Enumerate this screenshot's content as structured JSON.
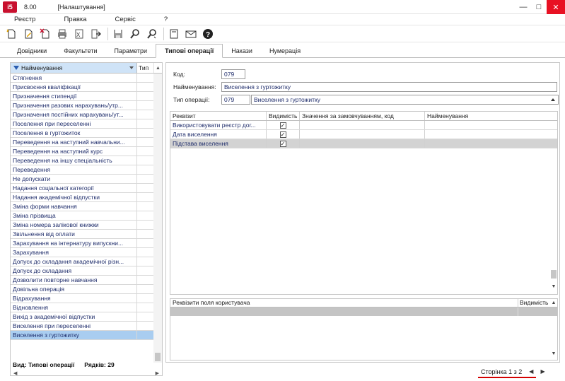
{
  "app": {
    "logo_text": "i5",
    "version": "8.00",
    "window_title": "[Налаштування]",
    "accent_color": "#c8102e"
  },
  "window_controls": {
    "minimize": "—",
    "maximize": "□",
    "close": "✕"
  },
  "menu": [
    {
      "label": "Реєстр"
    },
    {
      "label": "Правка"
    },
    {
      "label": "Сервіс"
    },
    {
      "label": "?"
    }
  ],
  "toolbar": {
    "icons": [
      "new-icon",
      "edit-icon",
      "delete-icon",
      "print-icon",
      "excel-icon",
      "export-icon",
      "save-icon",
      "search-icon",
      "search-next-icon",
      "form-icon",
      "mail-icon",
      "help-icon"
    ]
  },
  "tabs": [
    {
      "label": "Довідники",
      "active": false
    },
    {
      "label": "Факультети",
      "active": false
    },
    {
      "label": "Параметри",
      "active": false
    },
    {
      "label": "Типові операції",
      "active": true
    },
    {
      "label": "Накази",
      "active": false
    },
    {
      "label": "Нумерація",
      "active": false
    }
  ],
  "left_list": {
    "col_name": "Найменування",
    "col_type": "Тип",
    "items": [
      "Стягнення",
      "Присвоєння кваліфікації",
      "Призначення стипендії",
      "Призначення разових нарахувань/утр...",
      "Призначення постійних нарахувань/ут...",
      "Поселення при переселенні",
      "Поселення в гуртожиток",
      "Переведення на наступний навчальни...",
      "Переведення на наступний курс",
      "Переведення на іншу спеціальність",
      "Переведення",
      "Не допускати",
      "Надання соціальної категорії",
      "Надання академічної відпустки",
      "Зміна форми навчання",
      "Зміна прізвища",
      "Зміна номера залікової книжки",
      "Звільнення від оплати",
      "Зарахування на інтернатуру випускни...",
      "Зарахування",
      "Допуск до складання академічної різн...",
      "Допуск до складання",
      "Дозволити повторне навчання",
      "Довільна операція",
      "Відрахування",
      "Відновлення",
      "Вихід з академічної відпустки",
      "Виселення при переселенні",
      "Виселення з гуртожитку"
    ],
    "selected_index": 28,
    "footer_view": "Вид: Типові операції",
    "footer_rows": "Рядків: 29"
  },
  "form": {
    "code_label": "Код:",
    "code_value": "079",
    "name_label": "Найменування:",
    "name_value": "Виселення з гуртожитку",
    "optype_label": "Тип операції:",
    "optype_code": "079",
    "optype_name": "Виселення з гуртожитку"
  },
  "props_grid": {
    "headers": [
      "Реквізит",
      "Видимість",
      "Значення за замовчуванням, код",
      "Найменування"
    ],
    "rows": [
      {
        "name": "Використовувати реєстр дог...",
        "visible": true,
        "check": "✓"
      },
      {
        "name": "Дата виселення",
        "visible": true,
        "check": "✓"
      },
      {
        "name": "Підстава виселення",
        "visible": true,
        "check": "✓"
      }
    ],
    "selected_index": 2
  },
  "user_grid": {
    "headers": [
      "Реквізити поля користувача",
      "Видимість"
    ]
  },
  "pager": {
    "text": "Сторінка 1 з 2",
    "prev": "◀",
    "next": "▶"
  }
}
